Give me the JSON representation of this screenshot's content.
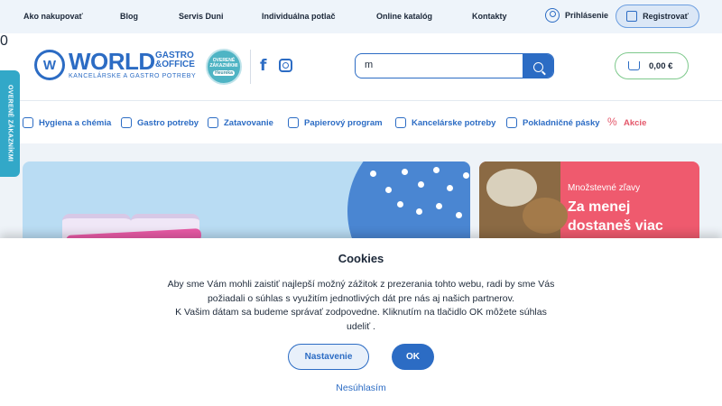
{
  "topbar": {
    "links": [
      "Ako nakupovať",
      "Blog",
      "Servis Duni",
      "Individuálna potlač",
      "Online katalóg",
      "Kontakty"
    ],
    "login_label": "Prihlásenie",
    "register_label": "Registrovať"
  },
  "header": {
    "logo_letter": "W",
    "brand_name": "WORLD",
    "brand_tag_1": "GASTRO",
    "brand_tag_2": "&OFFICE",
    "brand_subtitle": "KANCELÁRSKE A GASTRO POTREBY",
    "badge_line1": "OVERENÉ",
    "badge_line2": "ZÁKAZNÍKMI",
    "badge_source": "Heureka",
    "facebook_icon": "facebook-icon",
    "instagram_icon": "instagram-icon",
    "search_value": "m",
    "cart_count": "0",
    "cart_total": "0,00 €"
  },
  "categories": [
    {
      "label": "Hygiena a chémia",
      "icon": "spray-icon"
    },
    {
      "label": "Gastro potreby",
      "icon": "cutlery-icon"
    },
    {
      "label": "Zatavovanie",
      "icon": "laminator-icon"
    },
    {
      "label": "Papierový program",
      "icon": "paper-cup-icon"
    },
    {
      "label": "Kancelárske potreby",
      "icon": "stapler-icon"
    },
    {
      "label": "Pokladničné pásky",
      "icon": "receipt-icon"
    },
    {
      "label": "Akcie",
      "icon": "percent-icon"
    }
  ],
  "side_tab": "OVERENÉ ZÁKAZNÍKMI",
  "promo": {
    "subtitle": "Množstevné zľavy",
    "title_line1": "Za menej",
    "title_line2": "dostaneš viac"
  },
  "cookies": {
    "title": "Cookies",
    "text_line1": "Aby sme Vám mohli zaistiť najlepší možný zážitok z prezerania tohto webu, radi by sme Vás",
    "text_line2": "požiadali o súhlas s využitím jednotlivých dát pre nás aj našich partnerov.",
    "text_line3": "K Vašim dátam sa budeme správať zodpovedne. Kliknutím na tlačidlo OK môžete súhlas",
    "text_line4": "udeliť .",
    "settings_label": "Nastavenie",
    "ok_label": "OK",
    "decline_label": "Nesúhlasím"
  },
  "colors": {
    "accent": "#2c6cc4",
    "sale": "#e4576a",
    "side_tab": "#32a8c8",
    "promo_bg": "#ef5a6e",
    "cart_border": "#7ec98c"
  }
}
